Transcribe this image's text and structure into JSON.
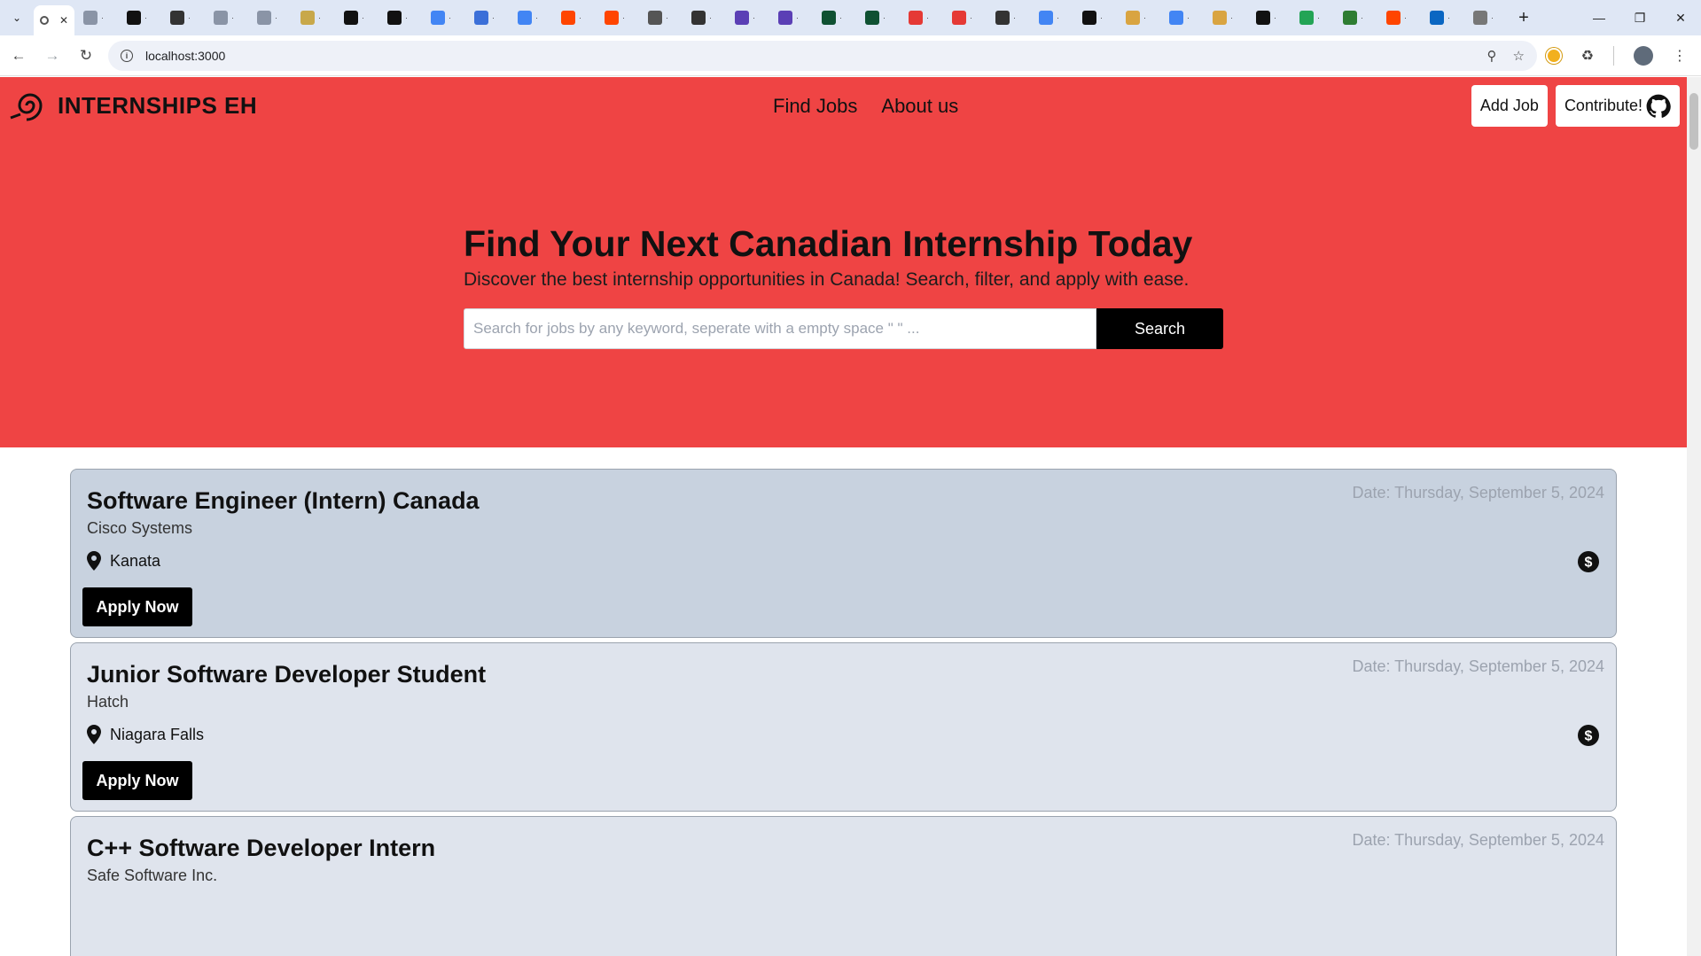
{
  "browser": {
    "url": "localhost:3000",
    "tab_colors": [
      "#8a94a6",
      "#111111",
      "#333333",
      "#8a94a6",
      "#8a94a6",
      "#c8a84a",
      "#111111",
      "#111111",
      "#4285f4",
      "#3b6fd8",
      "#4285f4",
      "#ff4500",
      "#ff4500",
      "#555555",
      "#333333",
      "#5b3fb5",
      "#5b3fb5",
      "#0f5132",
      "#0f5132",
      "#e53935",
      "#e53935",
      "#333333",
      "#4285f4",
      "#111111",
      "#d9a441",
      "#4285f4",
      "#d9a441",
      "#111111",
      "#23a455",
      "#2e7d32",
      "#ff4500",
      "#0a66c2",
      "#777777"
    ]
  },
  "site": {
    "brand": "INTERNSHIPS EH",
    "nav": {
      "find_jobs": "Find Jobs",
      "about_us": "About us"
    },
    "add_job": "Add Job",
    "contribute": "Contribute!",
    "hero_title": "Find Your Next Canadian Internship Today",
    "hero_subtitle": "Discover the best internship opportunities in Canada! Search, filter, and apply with ease.",
    "search_placeholder": "Search for jobs by any keyword, seperate with a empty space \" \" ...",
    "search_button": "Search",
    "apply_label": "Apply Now",
    "colors": {
      "header_bg": "#ef4444",
      "card_bg": "#dfe4ed",
      "card_bg_first": "#c8d2df"
    }
  },
  "jobs": [
    {
      "title": "Software Engineer (Intern) Canada",
      "company": "Cisco Systems",
      "location": "Kanata",
      "date": "Date: Thursday, September 5, 2024"
    },
    {
      "title": "Junior Software Developer Student",
      "company": "Hatch",
      "location": "Niagara Falls",
      "date": "Date: Thursday, September 5, 2024"
    },
    {
      "title": "C++ Software Developer Intern",
      "company": "Safe Software Inc.",
      "location": "",
      "date": "Date: Thursday, September 5, 2024"
    }
  ]
}
